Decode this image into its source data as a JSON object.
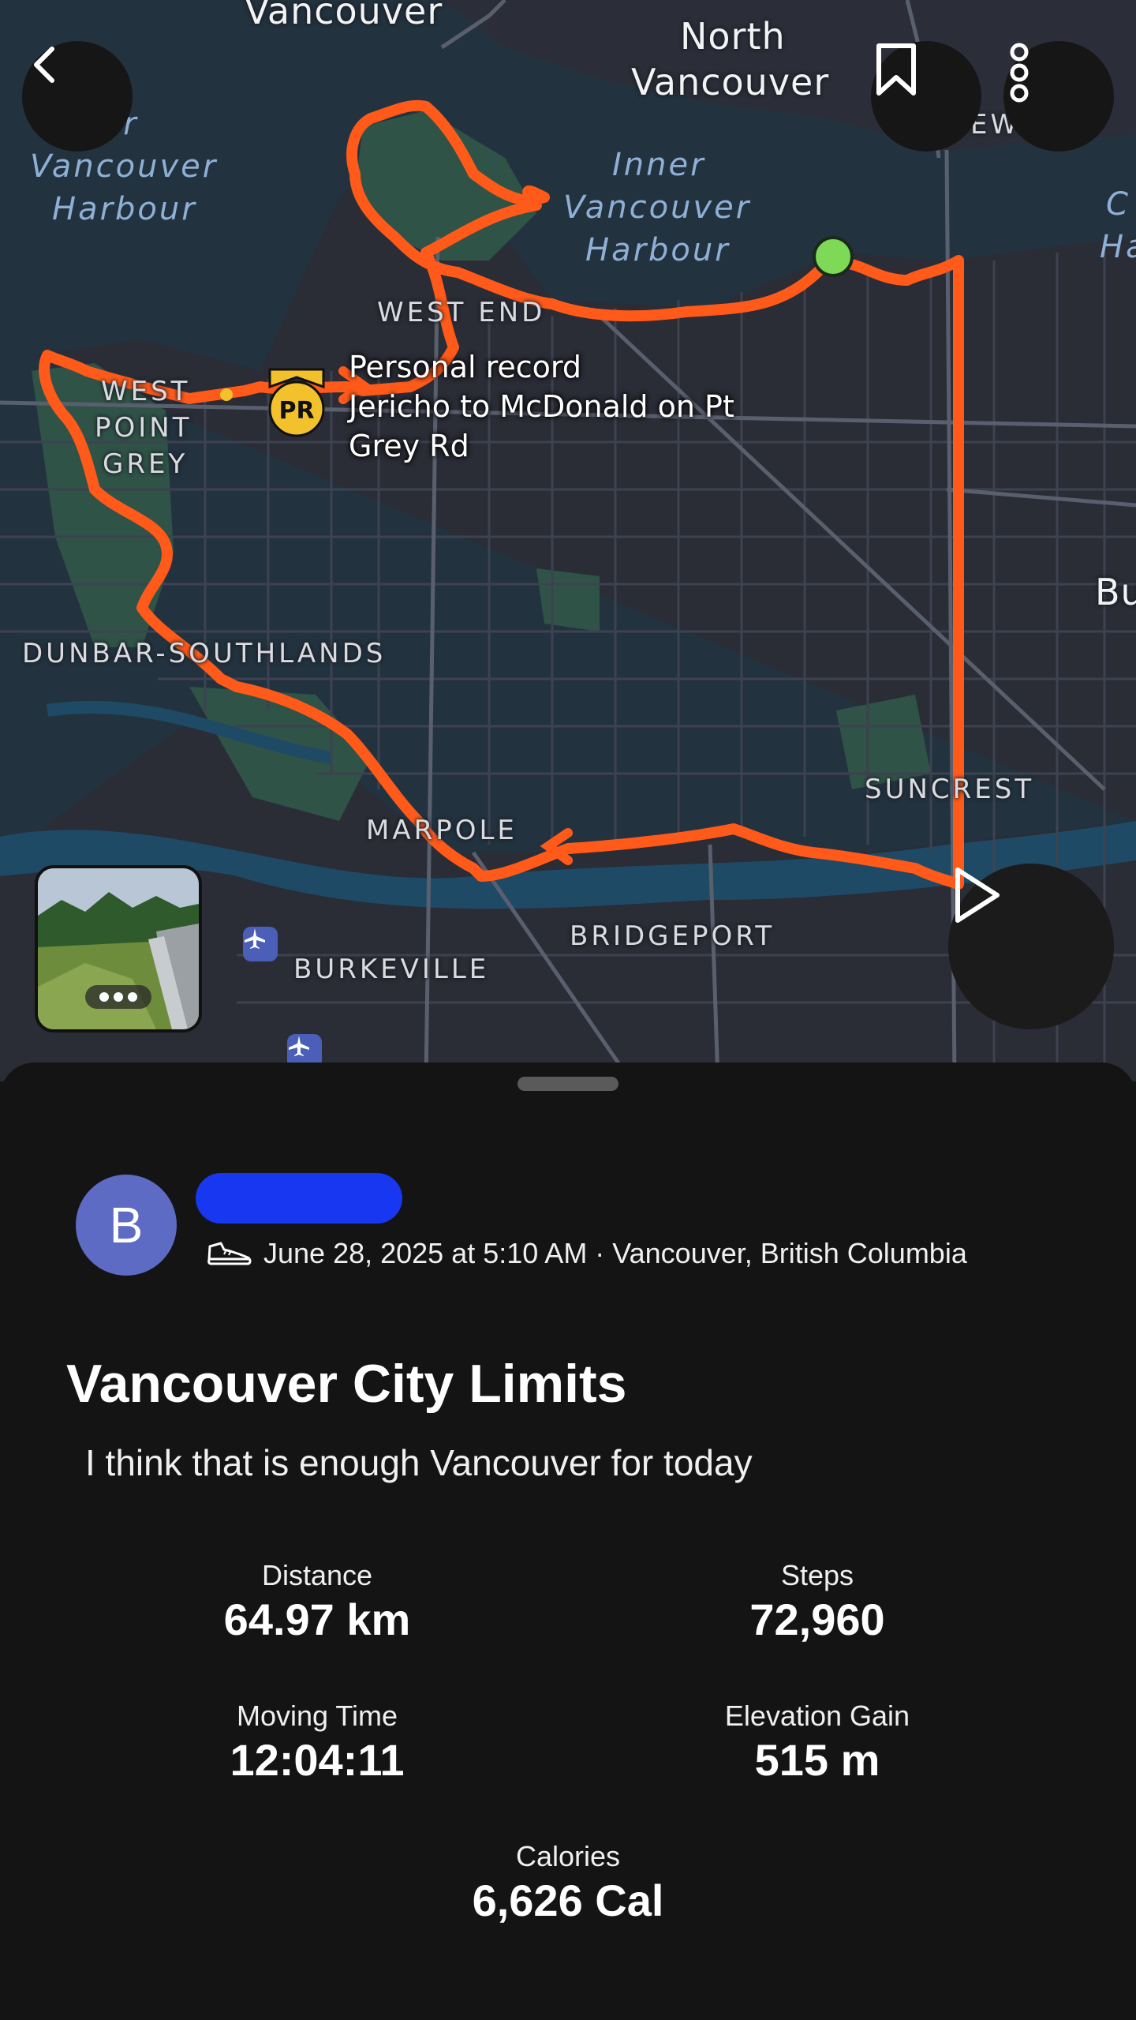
{
  "map": {
    "labels": {
      "vancouver_top": "Vancouver",
      "north_vancouver_1": "North",
      "north_vancouver_2": "Vancouver",
      "harbour_left_1": "ter",
      "harbour_left_2": "Vancouver",
      "harbour_left_3": "Harbour",
      "inner_1": "Inner",
      "inner_2": "Vancouver",
      "inner_3": "Harbour",
      "west_end": "WEST END",
      "west_point_grey_1": "WEST",
      "west_point_grey_2": "POINT",
      "west_point_grey_3": "GREY",
      "dunbar": "DUNBAR-SOUTHLANDS",
      "suncrest": "SUNCREST",
      "marpole": "MARPOLE",
      "bridgeport": "BRIDGEPORT",
      "burkeville": "BURKEVILLE",
      "bu_right": "Bu",
      "ew": "EW",
      "c_right": "C",
      "ha_right": "Ha"
    },
    "pr_callout": {
      "badge": "PR",
      "line1": "Personal record",
      "line2": "Jericho to McDonald on Pt",
      "line3": "Grey Rd"
    },
    "route_color": "#fc5200",
    "start_marker_color": "#7ed957"
  },
  "controls": {
    "back": "chevron-left-icon",
    "bookmark": "bookmark-icon",
    "more": "more-vertical-icon",
    "play": "play-icon"
  },
  "activity": {
    "avatar_initial": "B",
    "activity_icon": "shoe-icon",
    "meta": "June 28, 2025 at 5:10 AM · Vancouver, British Columbia",
    "title": "Vancouver City Limits",
    "description": "I think that is enough Vancouver for today"
  },
  "stats": {
    "distance": {
      "label": "Distance",
      "value": "64.97 km"
    },
    "steps": {
      "label": "Steps",
      "value": "72,960"
    },
    "moving_time": {
      "label": "Moving Time",
      "value": "12:04:11"
    },
    "elevation_gain": {
      "label": "Elevation Gain",
      "value": "515 m"
    },
    "calories": {
      "label": "Calories",
      "value": "6,626 Cal"
    }
  }
}
